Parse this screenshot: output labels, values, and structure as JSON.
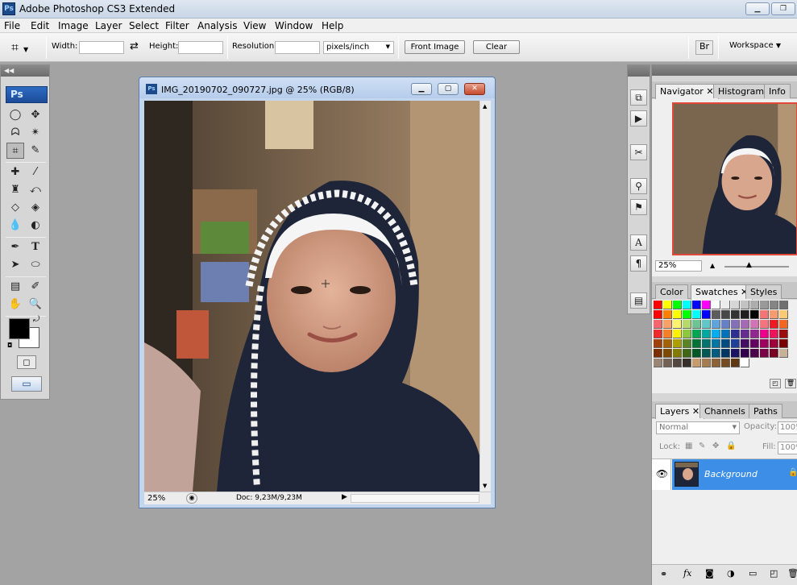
{
  "app": {
    "title": "Adobe Photoshop CS3 Extended",
    "logo_text": "Ps",
    "window_buttons": {
      "minimize": "▁",
      "restore": "❐"
    }
  },
  "menu": [
    "File",
    "Edit",
    "Image",
    "Layer",
    "Select",
    "Filter",
    "Analysis",
    "View",
    "Window",
    "Help"
  ],
  "options": {
    "width_label": "Width:",
    "height_label": "Height:",
    "resolution_label": "Resolution:",
    "units_value": "pixels/inch",
    "front_image_label": "Front Image",
    "clear_label": "Clear",
    "workspace_label": "Workspace"
  },
  "document": {
    "title": "IMG_20190702_090727.jpg @ 25% (RGB/8)",
    "zoom": "25%",
    "doc_info": "Doc: 9,23M/9,23M"
  },
  "panels": {
    "navigator_tabs": [
      "Navigator",
      "Histogram",
      "Info"
    ],
    "navigator_zoom": "25%",
    "color_tabs": [
      "Color",
      "Swatches",
      "Styles"
    ],
    "layers_tabs": [
      "Layers",
      "Channels",
      "Paths"
    ],
    "blend_mode": "Normal",
    "opacity_label": "Opacity:",
    "opacity_value": "100%",
    "lock_label": "Lock:",
    "fill_label": "Fill:",
    "fill_value": "100%",
    "layer_name": "Background"
  },
  "colors": {
    "foreground": "#000000",
    "background": "#ffffff",
    "layer_selected": "#3c8ee6"
  },
  "swatches": [
    [
      "#ff0000",
      "#ffff00",
      "#00ff00",
      "#00ffff",
      "#0000ff",
      "#ff00ff",
      "#ffffff",
      "#ebebeb",
      "#d6d6d6",
      "#c2c2c2",
      "#adadad",
      "#999999",
      "#858585",
      "#707070"
    ],
    [
      "#ff0000",
      "#ff8000",
      "#ffff00",
      "#00ff00",
      "#00ffff",
      "#0000ff",
      "#5c5c5c",
      "#474747",
      "#333333",
      "#1f1f1f",
      "#000000",
      "#f27474",
      "#f79c71",
      "#fbc973"
    ],
    [
      "#f6666c",
      "#f9a066",
      "#fff36b",
      "#b6d96c",
      "#6cc592",
      "#5fc8c6",
      "#5fa4da",
      "#6580c4",
      "#8470b7",
      "#a56ab4",
      "#d174b5",
      "#f6737f",
      "#ed1c24",
      "#f26522"
    ],
    [
      "#ee2a2d",
      "#f57f26",
      "#fef200",
      "#8dc63f",
      "#00a651",
      "#00a99d",
      "#00aeef",
      "#0072bc",
      "#2e3192",
      "#662d91",
      "#92278f",
      "#ec008c",
      "#ed145b",
      "#9e0b0f"
    ],
    [
      "#a0410d",
      "#a36209",
      "#aba000",
      "#598527",
      "#007236",
      "#00746b",
      "#0076a3",
      "#004b80",
      "#21409a",
      "#440e62",
      "#630460",
      "#9e005d",
      "#9e0039",
      "#790000"
    ],
    [
      "#7b2e00",
      "#7d4900",
      "#827b00",
      "#406618",
      "#005826",
      "#005952",
      "#005b7f",
      "#003663",
      "#1b1464",
      "#32004b",
      "#4b0049",
      "#7b0046",
      "#7a0026",
      "#c7b299"
    ],
    [
      "#998675",
      "#736357",
      "#534741",
      "#37302a",
      "#c69c6d",
      "#a67c52",
      "#8c6239",
      "#754c24",
      "#603913",
      "#fff"
    ]
  ]
}
